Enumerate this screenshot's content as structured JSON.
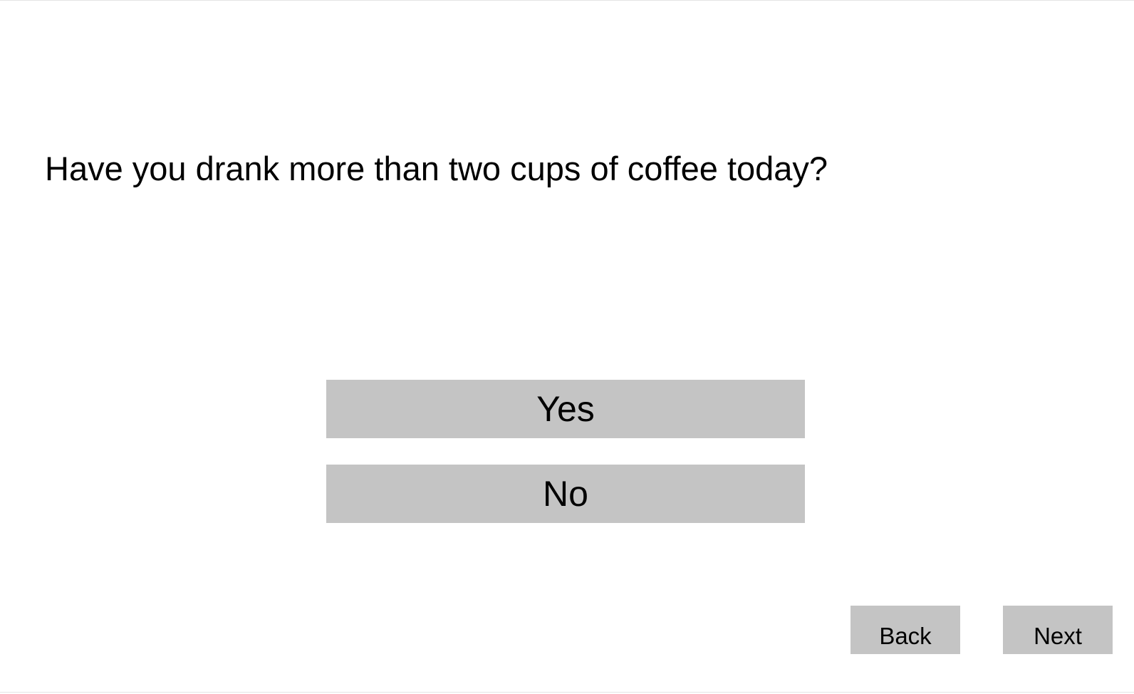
{
  "question": {
    "text": "Have you drank more than two cups of coffee today?"
  },
  "answers": {
    "options": [
      {
        "label": "Yes"
      },
      {
        "label": "No"
      }
    ]
  },
  "navigation": {
    "back_label": "Back",
    "next_label": "Next"
  },
  "colors": {
    "background": "#ffffff",
    "button": "#c4c4c4",
    "text": "#000000"
  }
}
